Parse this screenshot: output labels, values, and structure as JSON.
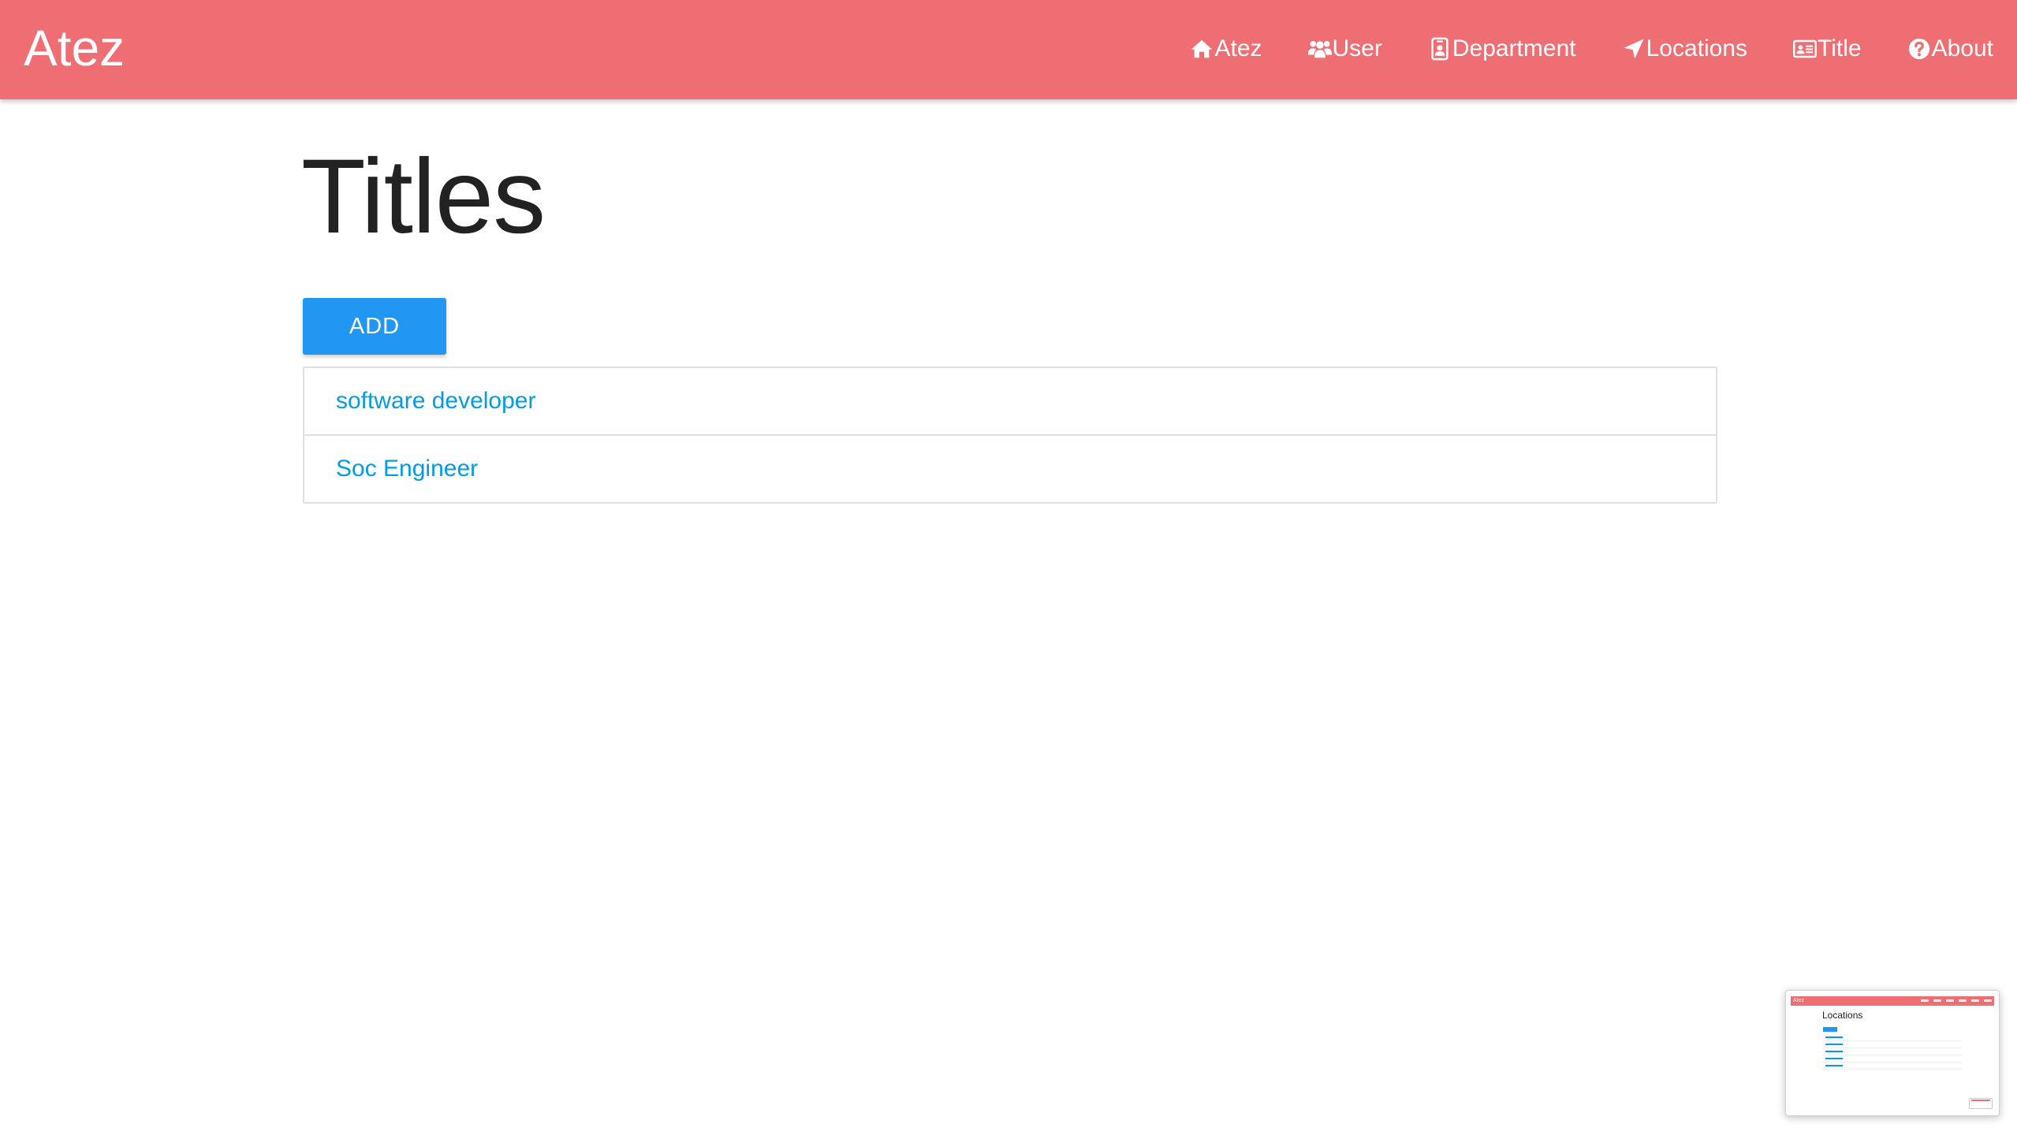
{
  "navbar": {
    "brand": "Atez",
    "bg_color": "#ee6e73",
    "items": [
      {
        "label": "Atez",
        "icon": "home-icon"
      },
      {
        "label": "User",
        "icon": "users-icon"
      },
      {
        "label": "Department",
        "icon": "id-badge-icon"
      },
      {
        "label": "Locations",
        "icon": "location-arrow-icon"
      },
      {
        "label": "Title",
        "icon": "id-card-icon"
      },
      {
        "label": "About",
        "icon": "question-circle-icon"
      }
    ]
  },
  "main": {
    "title": "Titles",
    "add_button": {
      "label": "ADD",
      "color": "#2196f3"
    },
    "items": [
      {
        "label": "software developer"
      },
      {
        "label": "Soc Engineer"
      }
    ],
    "link_color": "#039be5"
  },
  "thumbnail": {
    "brand": "Atez",
    "title": "Locations"
  }
}
